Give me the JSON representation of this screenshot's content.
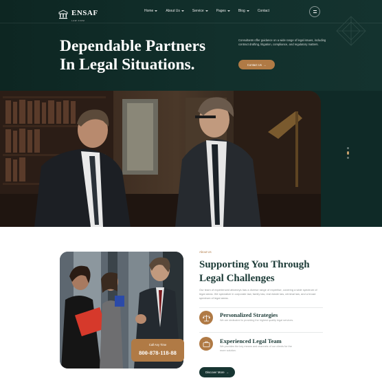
{
  "brand": {
    "name": "ENSAF",
    "tagline": "LAW FIRM"
  },
  "nav": {
    "items": [
      {
        "label": "Home",
        "dropdown": true
      },
      {
        "label": "About Us",
        "dropdown": true
      },
      {
        "label": "Service",
        "dropdown": true
      },
      {
        "label": "Pages",
        "dropdown": true
      },
      {
        "label": "Blog",
        "dropdown": true
      },
      {
        "label": "Contact",
        "dropdown": false
      }
    ],
    "menu_icon": "hamburger-icon"
  },
  "hero": {
    "title_line1": "Dependable Partners",
    "title_line2": "In Legal Situations.",
    "description": "Consultants offer guidance on a wide range of legal issues, including contract drafting, litigation, compliance, and regulatory matters.",
    "button_label": "Contact Us",
    "slider_dots": 3,
    "active_dot": 2
  },
  "about": {
    "kicker": "About Us",
    "title_line1": "Supporting You Through",
    "title_line2": "Legal Challenges",
    "description": "Our team of experienced attorneys has a diverse range of expertise, covering a wide spectrum of legal areas. We specialize in corporate law, family law, real estate law, criminal law, and a broad spectrum of legal areas.",
    "call_label": "Call Any Time",
    "call_number": "800-878-118-88",
    "features": [
      {
        "title": "Personalized Strategies",
        "text": "We are dedicated to providing the highest quality legal services.",
        "icon": "scales-icon"
      },
      {
        "title": "Experienced Legal Team",
        "text": "We provides the key means and channels of our clients for the more solution.",
        "icon": "briefcase-icon"
      }
    ],
    "button_label": "Discover More"
  },
  "colors": {
    "dark": "#0f2a27",
    "accent": "#b07a45",
    "title": "#1b3a36"
  }
}
